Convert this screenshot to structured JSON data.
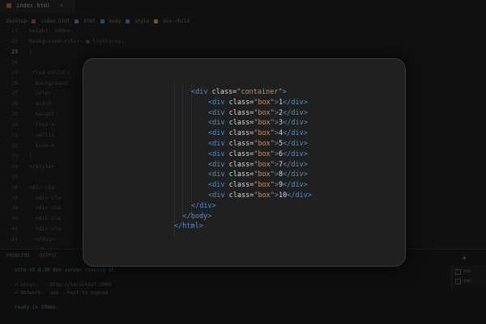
{
  "background": {
    "tab_label": "index.html",
    "tab_close": "×",
    "breadcrumb": [
      "Desktop",
      "index.html",
      "html",
      "body",
      "style",
      "box-child"
    ],
    "gutter_lines": [
      "21",
      "22",
      "23",
      "24",
      "25",
      "26",
      "27",
      "28",
      "29",
      "30",
      "31",
      "32",
      "33",
      "34",
      "35",
      "36",
      "37",
      "38",
      "39",
      "40",
      "41"
    ],
    "active_line": "23",
    "code_lines": [
      "height: 300px;",
      "background-color: ■ lightgray;",
      "}",
      "",
      ".flex-child {",
      "  background",
      "  color:",
      "  width:",
      "  height:",
      "  font-s",
      "  vertic",
      "  line-h",
      "}",
      "</style>",
      "",
      "<div cla",
      "  <div cla",
      "  <div cla",
      "  <div cla",
      "  <div cla",
      "  </div>",
      "  </body>",
      "</html>"
    ],
    "panel_tabs": [
      "PROBLEMS",
      "OUTPUT"
    ],
    "panel_lines": [
      "vite v5.0.10 dev server running at:",
      "> Local:    http://localhost:3000",
      "> Network:  use --host to expose",
      "ready in 190ms."
    ],
    "panel_plus": "+",
    "minimap_labels": [
      "zsh",
      "zsh"
    ]
  },
  "overlay": {
    "lines": [
      {
        "indent": 1,
        "open_tag": "<div",
        "attr": "class",
        "value": "\"container\"",
        "close": ">",
        "text": "",
        "end_tag": ""
      },
      {
        "indent": 2,
        "open_tag": "<div",
        "attr": "class",
        "value": "\"box\"",
        "close": ">",
        "text": "1",
        "end_tag": "</div>"
      },
      {
        "indent": 2,
        "open_tag": "<div",
        "attr": "class",
        "value": "\"box\"",
        "close": ">",
        "text": "2",
        "end_tag": "</div>"
      },
      {
        "indent": 2,
        "open_tag": "<div",
        "attr": "class",
        "value": "\"box\"",
        "close": ">",
        "text": "3",
        "end_tag": "</div>"
      },
      {
        "indent": 2,
        "open_tag": "<div",
        "attr": "class",
        "value": "\"box\"",
        "close": ">",
        "text": "4",
        "end_tag": "</div>"
      },
      {
        "indent": 2,
        "open_tag": "<div",
        "attr": "class",
        "value": "\"box\"",
        "close": ">",
        "text": "5",
        "end_tag": "</div>"
      },
      {
        "indent": 2,
        "open_tag": "<div",
        "attr": "class",
        "value": "\"box\"",
        "close": ">",
        "text": "6",
        "end_tag": "</div>"
      },
      {
        "indent": 2,
        "open_tag": "<div",
        "attr": "class",
        "value": "\"box\"",
        "close": ">",
        "text": "7",
        "end_tag": "</div>"
      },
      {
        "indent": 2,
        "open_tag": "<div",
        "attr": "class",
        "value": "\"box\"",
        "close": ">",
        "text": "8",
        "end_tag": "</div>"
      },
      {
        "indent": 2,
        "open_tag": "<div",
        "attr": "class",
        "value": "\"box\"",
        "close": ">",
        "text": "9",
        "end_tag": "</div>"
      },
      {
        "indent": 2,
        "open_tag": "<div",
        "attr": "class",
        "value": "\"box\"",
        "close": ">",
        "text": "10",
        "end_tag": "</div>"
      },
      {
        "indent": 1,
        "open_tag": "",
        "attr": "",
        "value": "",
        "close": "",
        "text": "",
        "end_tag": "</div>"
      },
      {
        "indent": 0.5,
        "open_tag": "",
        "attr": "",
        "value": "",
        "close": "",
        "text": "",
        "end_tag": "</body>"
      },
      {
        "indent": 0,
        "open_tag": "",
        "attr": "",
        "value": "",
        "close": "",
        "text": "",
        "end_tag": "</html>"
      }
    ],
    "colors": {
      "tag": "#4c8dd6",
      "string": "#d48a5a",
      "attr": "#cfd8e0",
      "text": "#d6d6d6"
    }
  }
}
